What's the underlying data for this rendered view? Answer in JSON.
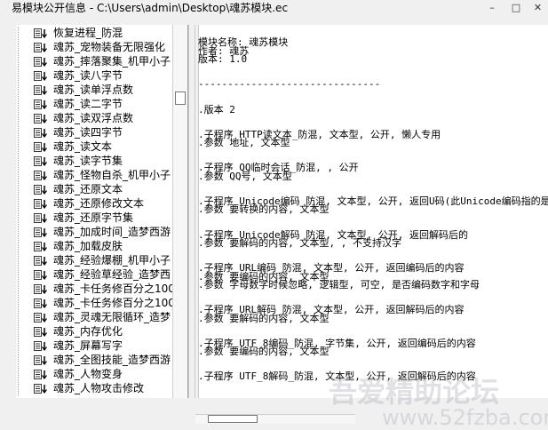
{
  "window": {
    "title": "易模块公开信息 - C:\\Users\\admin\\Desktop\\魂苏模块.ec",
    "min_glyph": "–",
    "max_glyph": "□",
    "close_glyph": "✕"
  },
  "tree": {
    "icon_name": "module-method-icon",
    "items": [
      "恢复进程_防混",
      "魂苏_宠物装备无限强化",
      "魂苏_摔落聚集_机甲小子",
      "魂苏_读八字节",
      "魂苏_读单浮点数",
      "魂苏_读二字节",
      "魂苏_读双浮点数",
      "魂苏_读四字节",
      "魂苏_读文本",
      "魂苏_读字节集",
      "魂苏_怪物自杀_机甲小子",
      "魂苏_还原文本",
      "魂苏_还原修改文本",
      "魂苏_还原字节集",
      "魂苏_加成时间_造梦西游",
      "魂苏_加载皮肤",
      "魂苏_经验爆棚_机甲小子",
      "魂苏_经验草经验_造梦西",
      "魂苏_卡任务修百分之100",
      "魂苏_卡任务修百分之100",
      "魂苏_灵魂无限循环_造梦",
      "魂苏_内存优化",
      "魂苏_屏幕写字",
      "魂苏_全图技能_造梦西游",
      "魂苏_人物变身",
      "魂苏_人物攻击修改"
    ]
  },
  "code": {
    "lines": [
      "",
      "模块名称: 魂苏模块",
      "作者: 魂苏",
      "版本: 1.0",
      "",
      "",
      "-------------------------------",
      "",
      "",
      ".版本 2",
      "",
      "",
      ".子程序 HTTP读文本_防混, 文本型, 公开, 懒人专用",
      ".参数 地址, 文本型",
      "",
      "",
      ".子程序 QQ临时会话_防混, , 公开",
      ".参数 QQ号, 文本型",
      "",
      "",
      ".子程序 Unicode编码_防混, 文本型, 公开, 返回U码(此Unicode编码指的是",
      ".参数 要转换的内容, 文本型",
      "",
      "",
      ".子程序 Unicode解码_防混, 文本型, 公开, 返回解码后的",
      ".参数 要解码的内容, 文本型, , 不支持汉字",
      "",
      "",
      ".子程序 URL编码_防混, 文本型, 公开, 返回编码后的内容",
      ".参数 要编码的内容, 文本型",
      ".参数 字母数字时候忽略, 逻辑型, 可空, 是否编码数字和字母",
      "",
      "",
      ".子程序 URL解码_防混, 文本型, 公开, 返回解码后的内容",
      ".参数 要解码的内容, 文本型",
      "",
      "",
      ".子程序 UTF_8编码_防混, 字节集, 公开, 返回编码后的内容",
      ".参数 要编码的内容, 文本型",
      "",
      "",
      ".子程序 UTF_8解码_防混, 文本型, 公开, 返回解码后的内容"
    ]
  },
  "watermark": {
    "cn": "吾爱精助论坛",
    "url": "www.52fzba.com"
  }
}
